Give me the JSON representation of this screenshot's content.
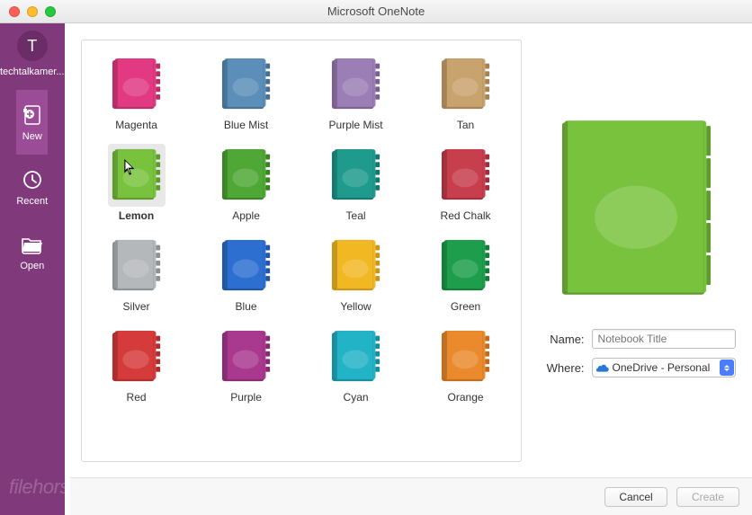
{
  "window": {
    "title": "Microsoft OneNote"
  },
  "account": {
    "initial": "T",
    "name": "techtalkamer..."
  },
  "sidebar": {
    "items": [
      {
        "id": "new",
        "label": "New"
      },
      {
        "id": "recent",
        "label": "Recent"
      },
      {
        "id": "open",
        "label": "Open"
      }
    ]
  },
  "picker": {
    "selected": "Lemon",
    "colors": [
      {
        "name": "Magenta",
        "fill": "#E13A82",
        "shade": "#B82E68"
      },
      {
        "name": "Blue Mist",
        "fill": "#5B8FB9",
        "shade": "#466F90"
      },
      {
        "name": "Purple Mist",
        "fill": "#9B7EB5",
        "shade": "#7A6090"
      },
      {
        "name": "Tan",
        "fill": "#C9A36E",
        "shade": "#A68354"
      },
      {
        "name": "Lemon",
        "fill": "#79C23E",
        "shade": "#5E9A2E"
      },
      {
        "name": "Apple",
        "fill": "#4FA836",
        "shade": "#3C8128"
      },
      {
        "name": "Teal",
        "fill": "#1F9B8E",
        "shade": "#16766C"
      },
      {
        "name": "Red Chalk",
        "fill": "#C73E4D",
        "shade": "#9E2F3C"
      },
      {
        "name": "Silver",
        "fill": "#B5B8BB",
        "shade": "#8E9194"
      },
      {
        "name": "Blue",
        "fill": "#2D6FD1",
        "shade": "#2255A3"
      },
      {
        "name": "Yellow",
        "fill": "#F2B824",
        "shade": "#C9951A"
      },
      {
        "name": "Green",
        "fill": "#1E9E4C",
        "shade": "#167A3A"
      },
      {
        "name": "Red",
        "fill": "#D63B3B",
        "shade": "#AD2E2E"
      },
      {
        "name": "Purple",
        "fill": "#A8398E",
        "shade": "#852C70"
      },
      {
        "name": "Cyan",
        "fill": "#22B3C7",
        "shade": "#198C9C"
      },
      {
        "name": "Orange",
        "fill": "#EA8A2D",
        "shade": "#BF6E21"
      }
    ]
  },
  "preview": {
    "fill": "#79C23E",
    "shade": "#5E9A2E"
  },
  "form": {
    "name_label": "Name:",
    "name_placeholder": "Notebook Title",
    "name_value": "",
    "where_label": "Where:",
    "where_value": "OneDrive - Personal"
  },
  "footer": {
    "cancel": "Cancel",
    "create": "Create"
  },
  "watermark": "filehorse.com"
}
